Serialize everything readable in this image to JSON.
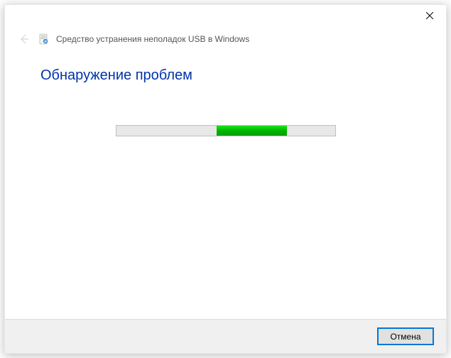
{
  "window": {
    "title": "Средство устранения неполадок USB в Windows"
  },
  "content": {
    "heading": "Обнаружение проблем"
  },
  "footer": {
    "cancel_label": "Отмена"
  }
}
